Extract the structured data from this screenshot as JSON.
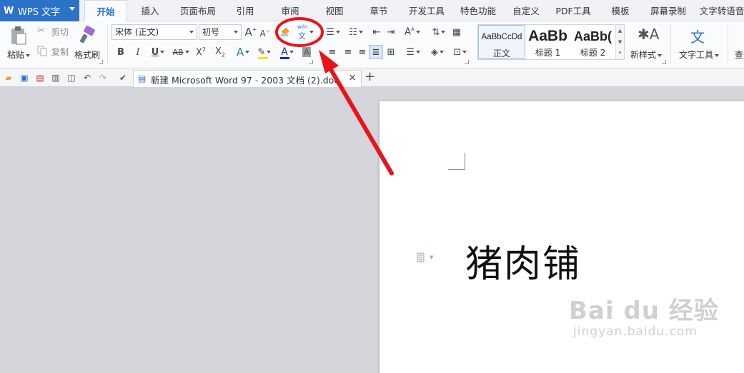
{
  "app": {
    "title": "WPS 文字"
  },
  "menu": {
    "tabs": [
      "开始",
      "插入",
      "页面布局",
      "引用",
      "审阅",
      "视图",
      "章节",
      "开发工具",
      "特色功能",
      "自定义",
      "PDF工具",
      "模板",
      "屏幕录制",
      "文字转语音"
    ],
    "active": "开始"
  },
  "clipboard": {
    "paste": "粘贴",
    "cut": "剪切",
    "copy": "复制",
    "format_painter": "格式刷"
  },
  "font": {
    "name": "宋体 (正文)",
    "size": "初号"
  },
  "phonetic": {
    "glyph_top": "wén",
    "glyph_bottom": "文"
  },
  "styles": {
    "items": [
      {
        "preview": "AaBbCcDd",
        "name": "正文"
      },
      {
        "preview": "AaBb",
        "name": "标题 1"
      },
      {
        "preview": "AaBb(",
        "name": "标题 2"
      }
    ],
    "new_style": "新样式",
    "text_tools": "文字工具",
    "find": "查"
  },
  "document_tab": {
    "title": "新建 Microsoft Word 97 - 2003 文档 (2).doc",
    "close": "×",
    "new": "+"
  },
  "document": {
    "body_text": "猪肉铺"
  },
  "watermark": {
    "brand": "Bai du 经验",
    "url": "jingyan.baidu.com"
  },
  "colors": {
    "accent": "#2b73c8",
    "annotation": "#e8141c",
    "font_color_bar": "#1f2aa8",
    "highlight_bar": "#f5e400"
  }
}
